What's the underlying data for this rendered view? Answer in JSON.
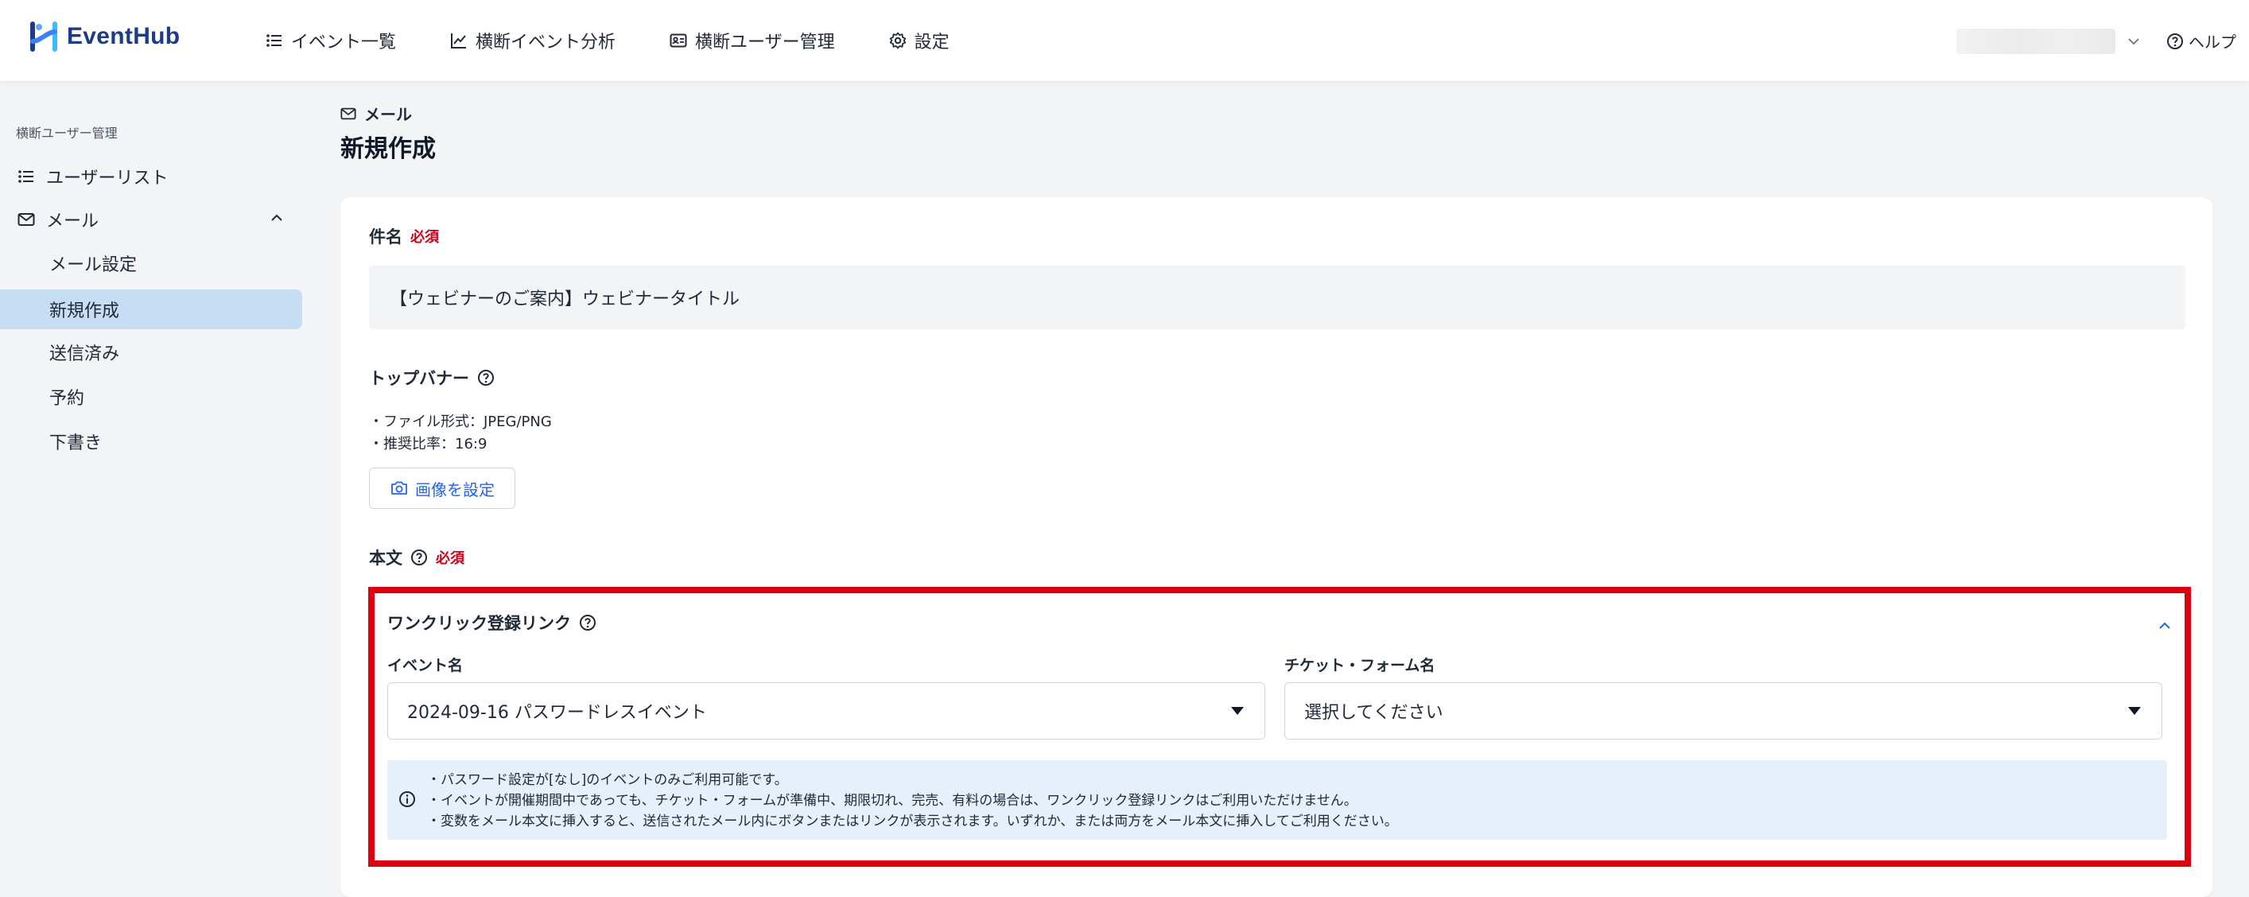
{
  "brand": {
    "name": "EventHub",
    "color": "#1e3a8a",
    "accent": "#2563eb"
  },
  "header": {
    "nav": [
      {
        "label": "イベント一覧",
        "icon": "list-icon"
      },
      {
        "label": "横断イベント分析",
        "icon": "chart-line-icon"
      },
      {
        "label": "横断ユーザー管理",
        "icon": "id-card-icon"
      },
      {
        "label": "設定",
        "icon": "gear-icon"
      }
    ],
    "help_label": "ヘルプ"
  },
  "sidebar": {
    "section_title": "横断ユーザー管理",
    "user_list_label": "ユーザーリスト",
    "mail_label": "メール",
    "sub_items": [
      "メール設定",
      "新規作成",
      "送信済み",
      "予約",
      "下書き"
    ],
    "active_index": 1
  },
  "main": {
    "breadcrumb": "メール",
    "title": "新規作成",
    "required_badge": "必須",
    "subject": {
      "label": "件名",
      "value": "【ウェビナーのご案内】ウェビナータイトル"
    },
    "banner": {
      "label": "トップバナー",
      "notes": [
        "・ファイル形式：JPEG/PNG",
        "・推奨比率：16:9"
      ],
      "button_label": "画像を設定"
    },
    "body_label": "本文",
    "one_click": {
      "title": "ワンクリック登録リンク",
      "event_label": "イベント名",
      "event_value": "2024-09-16 パスワードレスイベント",
      "ticket_label": "チケット・フォーム名",
      "ticket_placeholder": "選択してください",
      "info": [
        "・パスワード設定が[なし]のイベントのみご利用可能です。",
        "・イベントが開催期間中であっても、チケット・フォームが準備中、期限切れ、完売、有料の場合は、ワンクリック登録リンクはご利用いただけません。",
        "・変数をメール本文に挿入すると、送信されたメール内にボタンまたはリンクが表示されます。いずれか、または両方をメール本文に挿入してご利用ください。"
      ]
    }
  },
  "colors": {
    "highlight_border": "#dc0010",
    "active_nav_bg": "#c7ddf3",
    "info_bg": "#e6f0fa",
    "required": "#d0021b"
  }
}
